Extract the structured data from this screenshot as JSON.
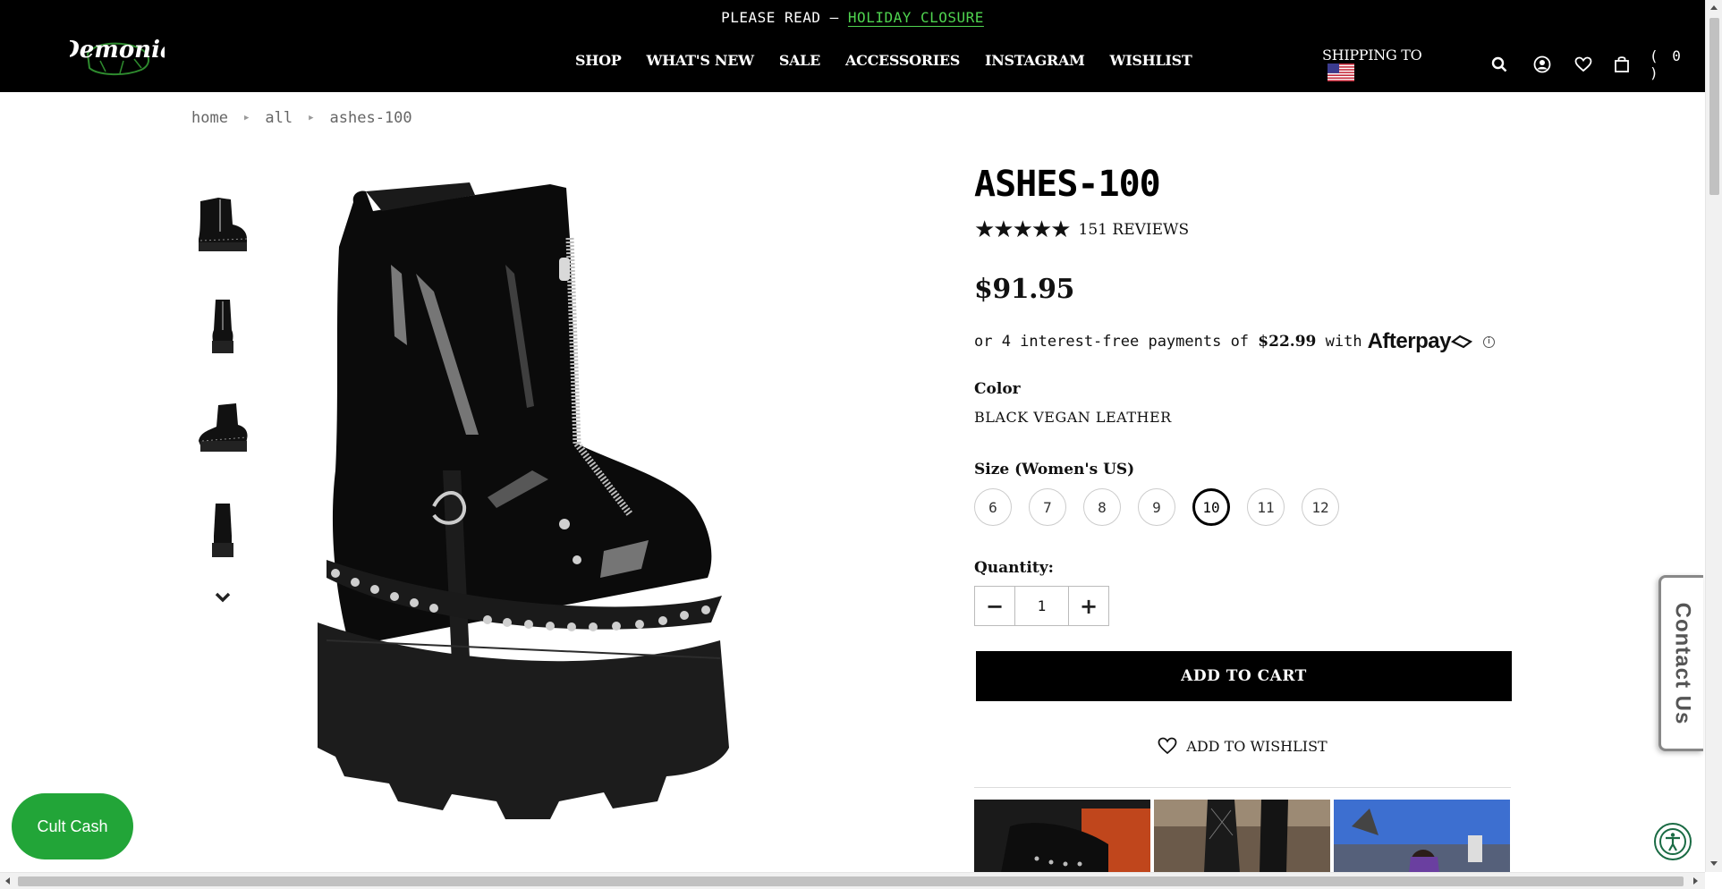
{
  "announcement": {
    "prefix": "PLEASE READ – ",
    "link": "HOLIDAY CLOSURE"
  },
  "header": {
    "logo_text": "Demonia",
    "nav": [
      "SHOP",
      "WHAT'S NEW",
      "SALE",
      "ACCESSORIES",
      "INSTAGRAM",
      "WISHLIST"
    ],
    "shipping_label": "SHIPPING TO",
    "cart_count": "( 0 )"
  },
  "breadcrumb": [
    "home",
    "all",
    "ashes-100"
  ],
  "product": {
    "title": "ASHES-100",
    "stars": "★★★★★",
    "rating": 5,
    "reviews": "151 REVIEWS",
    "price": "$91.95",
    "afterpay": {
      "text": "or 4 interest-free payments of",
      "amount": "$22.99",
      "with": "with",
      "brand": "Afterpay",
      "info": "i"
    },
    "color_label": "Color",
    "color_value": "BLACK VEGAN LEATHER",
    "size_label": "Size (Women's US)",
    "sizes": [
      "6",
      "7",
      "8",
      "9",
      "10",
      "11",
      "12"
    ],
    "selected_size": "10",
    "quantity_label": "Quantity:",
    "quantity": "1",
    "qty_minus": "−",
    "qty_plus": "+",
    "add_to_cart": "ADD TO CART",
    "add_to_wishlist": "ADD TO WISHLIST"
  },
  "floaters": {
    "contact": "Contact Us",
    "cult_cash": "Cult Cash"
  },
  "colors": {
    "header_bg": "#000000",
    "link_green": "#4fd34f",
    "cult_cash": "#22a538",
    "a11y": "#1a6b44"
  }
}
